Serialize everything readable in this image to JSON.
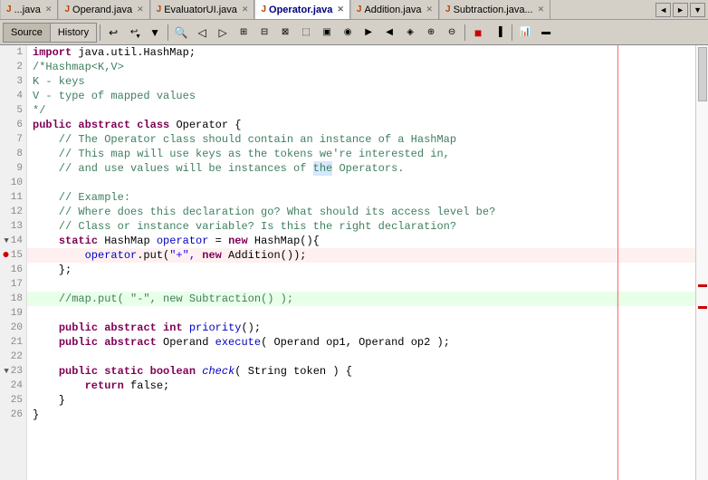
{
  "tabs": [
    {
      "label": "Operand.java",
      "icon": "java-icon",
      "active": false,
      "closeable": true
    },
    {
      "label": "EvaluatorUI.java",
      "icon": "java-icon",
      "active": false,
      "closeable": true
    },
    {
      "label": "Operator.java",
      "icon": "java-icon",
      "active": true,
      "closeable": true
    },
    {
      "label": "Addition.java",
      "icon": "java-icon",
      "active": false,
      "closeable": true
    },
    {
      "label": "Subtraction.java...",
      "icon": "java-icon",
      "active": false,
      "closeable": true
    }
  ],
  "toolbar": {
    "source_label": "Source",
    "history_label": "History"
  },
  "code_lines": [
    {
      "num": 1,
      "content": "import java.util.HashMap;",
      "highlight": false
    },
    {
      "num": 2,
      "content": "/*Hashmap<K,V>",
      "highlight": false
    },
    {
      "num": 3,
      "content": "K - keys",
      "highlight": false
    },
    {
      "num": 4,
      "content": "V - type of mapped values",
      "highlight": false
    },
    {
      "num": 5,
      "content": "*/",
      "highlight": false
    },
    {
      "num": 6,
      "content": "public abstract class Operator {",
      "highlight": false
    },
    {
      "num": 7,
      "content": "    // The Operator class should contain an instance of a HashMap",
      "highlight": false
    },
    {
      "num": 8,
      "content": "    // This map will use keys as the tokens we're interested in,",
      "highlight": false
    },
    {
      "num": 9,
      "content": "    // and use values will be instances of the Operators.",
      "highlight": false
    },
    {
      "num": 10,
      "content": "",
      "highlight": false
    },
    {
      "num": 11,
      "content": "    // Example:",
      "highlight": false
    },
    {
      "num": 12,
      "content": "    // Where does this declaration go? What should its access level be?",
      "highlight": false
    },
    {
      "num": 13,
      "content": "    // Class or instance variable? Is this the right declaration?",
      "highlight": false
    },
    {
      "num": 14,
      "content": "    static HashMap operator = new HashMap(){",
      "highlight": false
    },
    {
      "num": 15,
      "content": "        operator.put(\"+\", new Addition());",
      "highlight": false
    },
    {
      "num": 16,
      "content": "    };",
      "highlight": false
    },
    {
      "num": 17,
      "content": "",
      "highlight": false
    },
    {
      "num": 18,
      "content": "    //map.put( \"-\", new Subtraction() );",
      "highlight": true
    },
    {
      "num": 19,
      "content": "",
      "highlight": false
    },
    {
      "num": 20,
      "content": "    public abstract int priority();",
      "highlight": false
    },
    {
      "num": 21,
      "content": "    public abstract Operand execute( Operand op1, Operand op2 );",
      "highlight": false
    },
    {
      "num": 22,
      "content": "",
      "highlight": false
    },
    {
      "num": 23,
      "content": "    public static boolean check( String token ) {",
      "highlight": false
    },
    {
      "num": 24,
      "content": "        return false;",
      "highlight": false
    },
    {
      "num": 25,
      "content": "    }",
      "highlight": false
    },
    {
      "num": 26,
      "content": "}",
      "highlight": false
    }
  ],
  "line_markers": {
    "14": "fold",
    "15": "breakpoint",
    "18": "green-bar"
  }
}
